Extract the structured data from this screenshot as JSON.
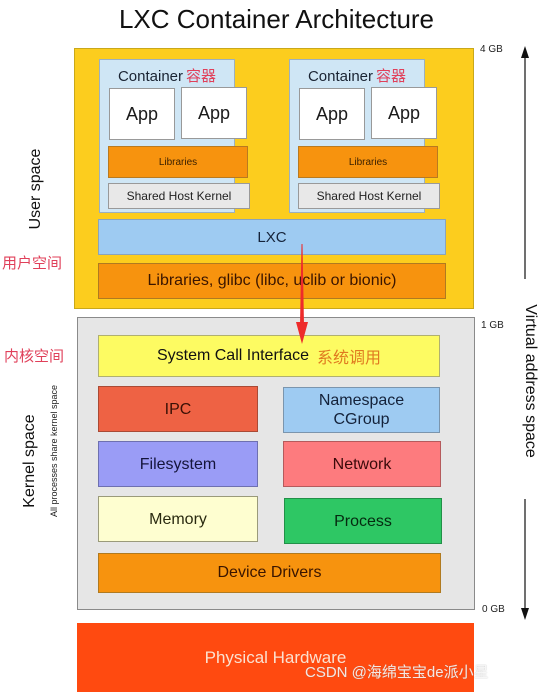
{
  "title": "LXC Container Architecture",
  "user_space": {
    "label": "User space",
    "label_cn": "用户空间",
    "containers": [
      {
        "title": "Container",
        "title_cn": "容器",
        "apps": [
          "App",
          "App"
        ],
        "libraries": "Libraries",
        "shared_kernel": "Shared Host Kernel"
      },
      {
        "title": "Container",
        "title_cn": "容器",
        "apps": [
          "App",
          "App"
        ],
        "libraries": "Libraries",
        "shared_kernel": "Shared Host Kernel"
      }
    ],
    "lxc": "LXC",
    "glibc": "Libraries, glibc (libc, uclib or bionic)"
  },
  "kernel_space": {
    "label": "Kernel space",
    "sublabel": "All processes share kernel space",
    "label_cn": "内核空间",
    "syscall": "System Call Interface",
    "syscall_cn": "系统调用",
    "blocks": {
      "ipc": "IPC",
      "namespace_line1": "Namespace",
      "namespace_line2": "CGroup",
      "filesystem": "Filesystem",
      "network": "Network",
      "memory": "Memory",
      "process": "Process",
      "device_drivers": "Device Drivers"
    }
  },
  "hardware": "Physical Hardware",
  "address_axis": {
    "label": "Virtual address space",
    "ticks": [
      "4 GB",
      "1 GB",
      "0 GB"
    ]
  },
  "watermark": "CSDN @海绵宝宝de派小星",
  "colors": {
    "user_space": "#fccd1e",
    "container": "#cfe6f5",
    "libraries": "#f7930e",
    "lxc": "#9ecbf2",
    "syscall": "#fdfb62",
    "ipc": "#ee6244",
    "filesystem": "#9a9cf6",
    "network": "#fd7b7e",
    "memory": "#fefed0",
    "process": "#2ec764",
    "hardware": "#ff4a10",
    "annotation_red": "#e0405a",
    "annotation_orange": "#e07a20"
  }
}
